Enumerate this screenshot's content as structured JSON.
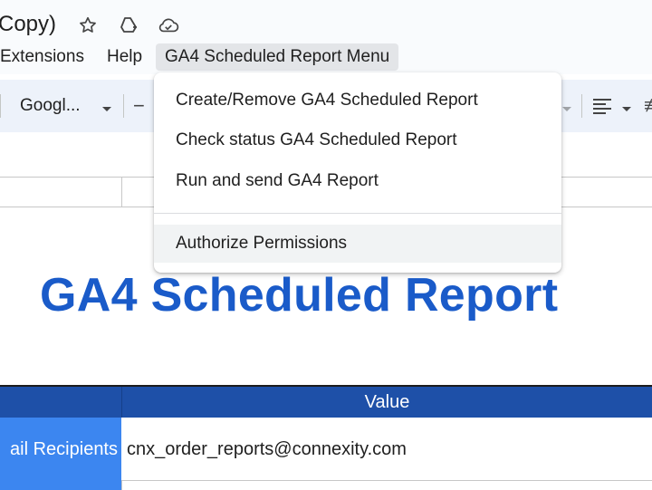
{
  "window": {
    "doc_title_fragment": "Copy)"
  },
  "menubar": {
    "items": [
      {
        "label": "Extensions"
      },
      {
        "label": "Help"
      },
      {
        "label": "GA4 Scheduled Report Menu"
      }
    ]
  },
  "toolbar": {
    "font_name": "Googl..."
  },
  "dropdown": {
    "items": [
      {
        "label": "Create/Remove GA4 Scheduled Report"
      },
      {
        "label": "Check status GA4 Scheduled Report"
      },
      {
        "label": "Run and send GA4 Report"
      },
      {
        "label": "Authorize Permissions"
      }
    ]
  },
  "sheet": {
    "title": "GA4 Scheduled Report",
    "table": {
      "header_value": "Value",
      "rows": [
        {
          "label": "ail Recipients",
          "value": "cnx_order_reports@connexity.com"
        }
      ]
    }
  },
  "colors": {
    "title_blue": "#1a5bc9",
    "header_blue": "#1e50a8",
    "label_blue": "#3c86f0"
  },
  "icons": {
    "star": "star-icon",
    "drive": "move-to-drive-icon",
    "cloud": "cloud-saved-icon"
  }
}
